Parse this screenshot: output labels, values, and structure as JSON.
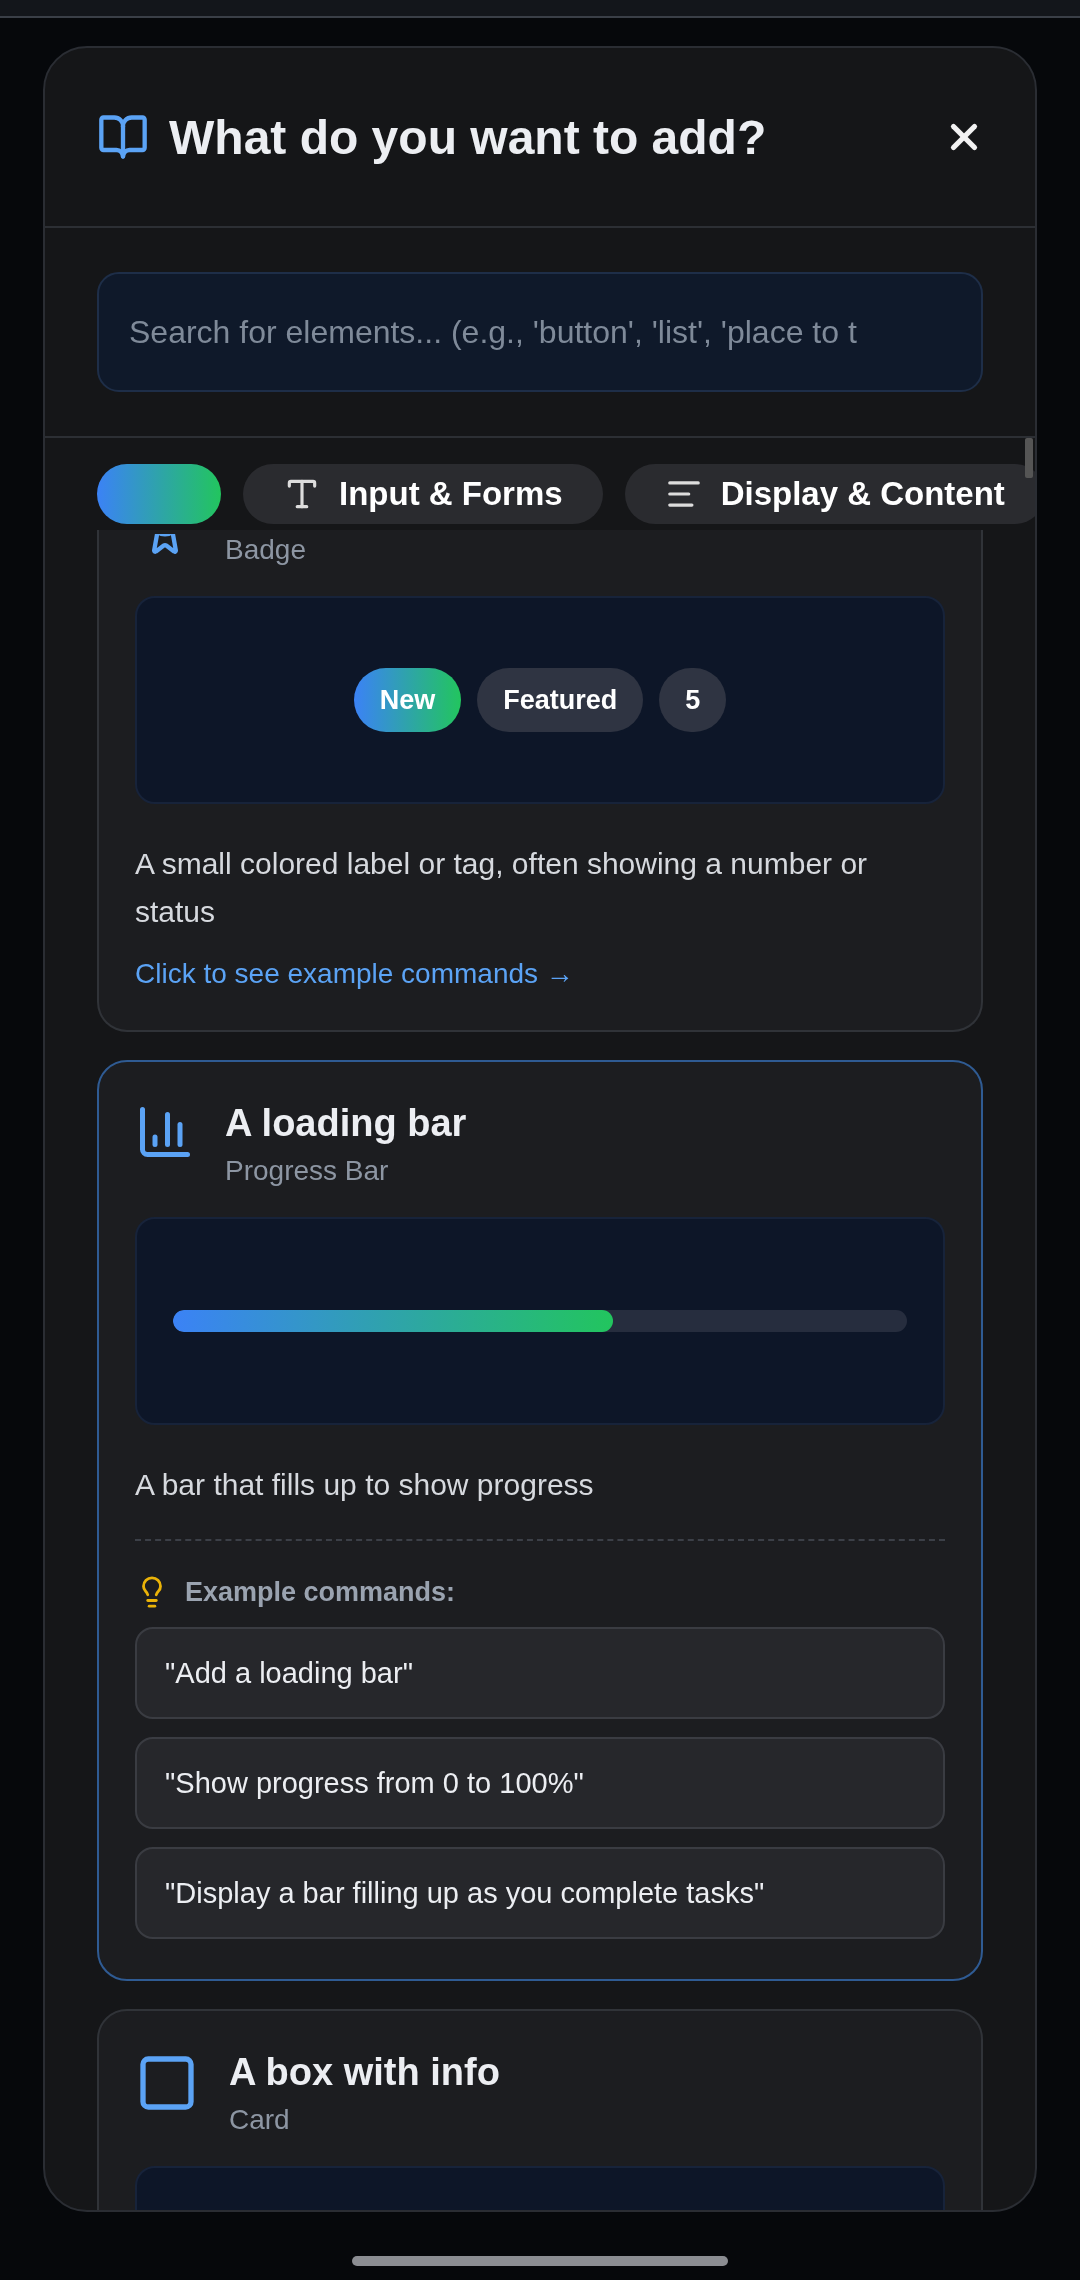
{
  "dialog": {
    "title": "What do you want to add?"
  },
  "search": {
    "placeholder": "Search for elements... (e.g., 'button', 'list', 'place to t"
  },
  "tabs": [
    {
      "kind": "all",
      "selected": true
    },
    {
      "kind": "input",
      "label": "Input & Forms",
      "selected": false
    },
    {
      "kind": "display",
      "label": "Display & Content",
      "selected": false
    }
  ],
  "cards": [
    {
      "kind": "badge",
      "subtitle": "Badge",
      "expanded": false,
      "badges": [
        {
          "label": "New",
          "kind": "accent"
        },
        {
          "label": "Featured",
          "kind": "plain"
        },
        {
          "label": "5",
          "kind": "plain"
        }
      ],
      "description": "A small colored label or tag, often showing a number or status",
      "link": "Click to see example commands →"
    },
    {
      "kind": "progress",
      "title": "A loading bar",
      "subtitle": "Progress Bar",
      "expanded": true,
      "level": 0.6,
      "description": "A bar that fills up to show progress",
      "examples_heading": "Example commands:",
      "examples": [
        "\"Add a loading bar\"",
        "\"Show progress from 0 to 100%\"",
        "\"Display a bar filling up as you complete tasks\""
      ]
    },
    {
      "kind": "card",
      "title": "A box with info",
      "subtitle": "Card",
      "expanded": false
    }
  ]
}
